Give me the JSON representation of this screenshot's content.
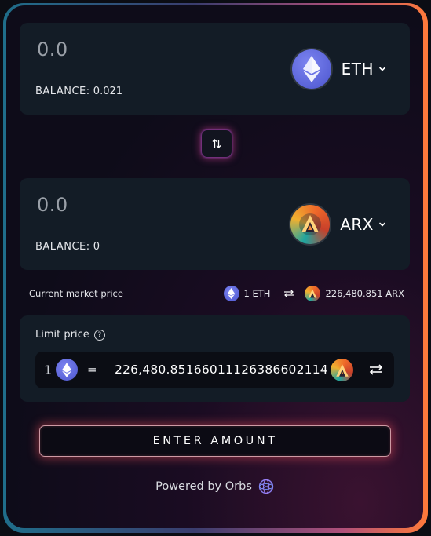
{
  "from": {
    "amount": "0.0",
    "balance_label": "BALANCE:",
    "balance_value": "0.021",
    "token_symbol": "ETH",
    "token_icon": "eth-diamond-icon"
  },
  "to": {
    "amount": "0.0",
    "balance_label": "BALANCE:",
    "balance_value": "0",
    "token_symbol": "ARX",
    "token_icon": "arx-logo-icon"
  },
  "swap": {
    "icon": "swap-vertical-arrows-icon"
  },
  "market": {
    "label": "Current market price",
    "left_value": "1 ETH",
    "right_value": "226,480.851 ARX",
    "icon": "swap-horizontal-arrows-icon"
  },
  "limit": {
    "title": "Limit price",
    "help_symbol": "?",
    "quantity": "1",
    "equals": "=",
    "price": "226,480.85166011126386602114",
    "invert_icon": "invert-arrows-icon"
  },
  "cta": {
    "label": "ENTER AMOUNT"
  },
  "footer": {
    "text": "Powered by Orbs",
    "logo": "orbs-logo-icon"
  },
  "colors": {
    "panel": "#131c26",
    "eth": "#6169e0",
    "accent_glow": "#f0505a"
  }
}
